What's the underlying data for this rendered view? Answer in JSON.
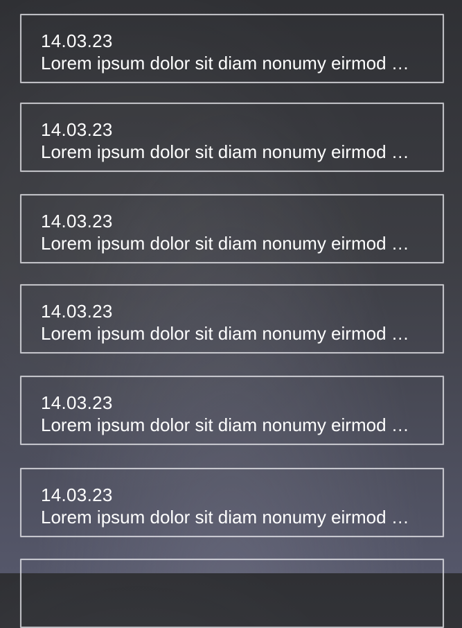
{
  "notes": [
    {
      "date": "14.03.23",
      "text": "Lorem ipsum dolor sit  diam nonumy eirmod …"
    },
    {
      "date": "14.03.23",
      "text": "Lorem ipsum dolor sit  diam nonumy eirmod …"
    },
    {
      "date": "14.03.23",
      "text": "Lorem ipsum dolor sit  diam nonumy eirmod …"
    },
    {
      "date": "14.03.23",
      "text": "Lorem ipsum dolor sit  diam nonumy eirmod …"
    },
    {
      "date": "14.03.23",
      "text": "Lorem ipsum dolor sit  diam nonumy eirmod …"
    },
    {
      "date": "14.03.23",
      "text": "Lorem ipsum dolor sit  diam nonumy eirmod …"
    },
    {
      "date": "",
      "text": ""
    }
  ],
  "colors": {
    "chalkboard": "#343539",
    "chalk": "#ffffff"
  }
}
